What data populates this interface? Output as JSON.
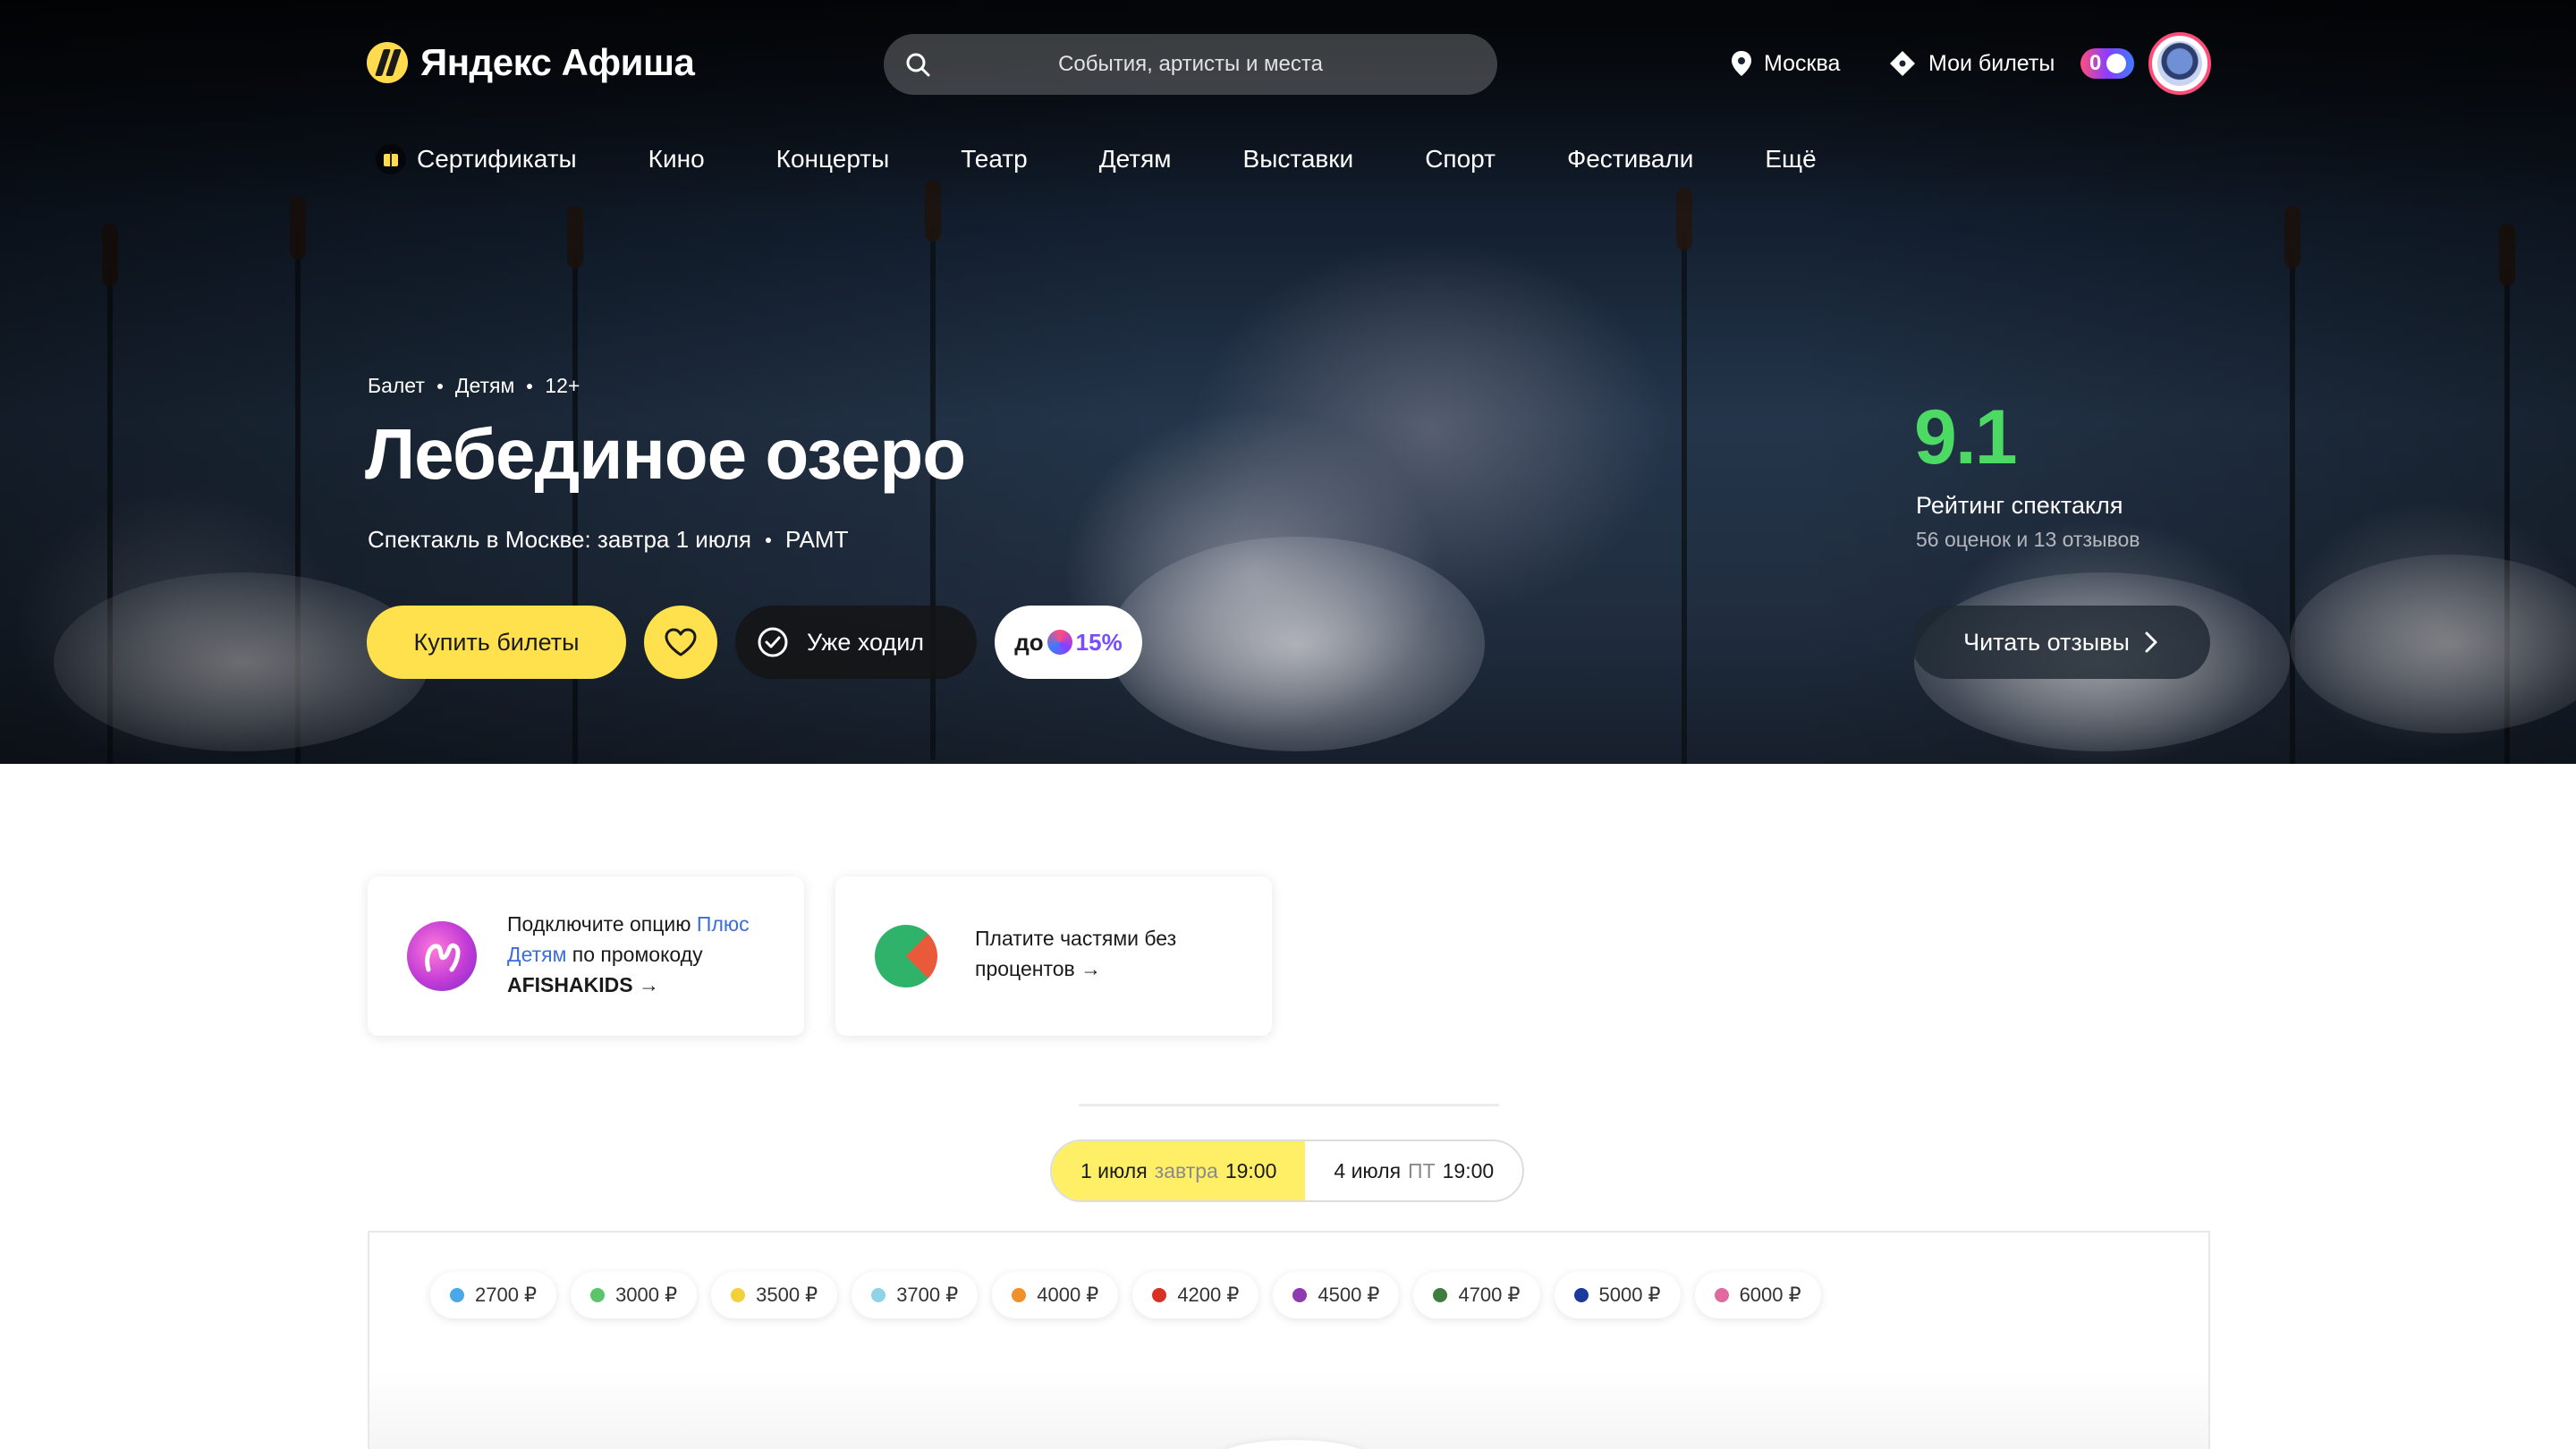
{
  "header": {
    "logo_text": "Яндекс Афиша",
    "search_placeholder": "События, артисты и места",
    "city": "Москва",
    "my_tickets": "Мои билеты",
    "plus_points": "0"
  },
  "nav": {
    "items": [
      "Сертификаты",
      "Кино",
      "Концерты",
      "Театр",
      "Детям",
      "Выставки",
      "Спорт",
      "Фестивали",
      "Ещё"
    ]
  },
  "event": {
    "tags": [
      "Балет",
      "Детям",
      "12+"
    ],
    "title": "Лебединое озеро",
    "subtitle_main": "Спектакль в Москве: завтра 1 июля",
    "venue": "РАМТ",
    "buy_label": "Купить билеты",
    "went_label": "Уже ходил",
    "cashback_prefix": "до",
    "cashback_value": "15%"
  },
  "rating": {
    "value": "9.1",
    "label": "Рейтинг спектакля",
    "count": "56 оценок  и 13 отзывов",
    "reviews_button": "Читать отзывы"
  },
  "promos": {
    "plus": {
      "text_1": "Подключите опцию ",
      "link": "Плюс Детям",
      "text_2": " по промокоду",
      "code": "AFISHAKIDS →"
    },
    "split": {
      "text": "Платите частями без процентов →"
    }
  },
  "dates": [
    {
      "date": "1 июля",
      "day": "завтра",
      "time": "19:00",
      "active": true
    },
    {
      "date": "4 июля",
      "day": "ПТ",
      "time": "19:00",
      "active": false
    }
  ],
  "prices": [
    {
      "label": "2700 ₽",
      "color": "#4aa8e8"
    },
    {
      "label": "3000 ₽",
      "color": "#5cc46a"
    },
    {
      "label": "3500 ₽",
      "color": "#f5cf3a"
    },
    {
      "label": "3700 ₽",
      "color": "#8fd3e8"
    },
    {
      "label": "4000 ₽",
      "color": "#f0902a"
    },
    {
      "label": "4200 ₽",
      "color": "#d93025"
    },
    {
      "label": "4500 ₽",
      "color": "#8e3ab0"
    },
    {
      "label": "4700 ₽",
      "color": "#3f7d3f"
    },
    {
      "label": "5000 ₽",
      "color": "#1a3a9c"
    },
    {
      "label": "6000 ₽",
      "color": "#e06aa0"
    }
  ],
  "colors": {
    "accent_yellow": "#ffe14d",
    "rating_green": "#4cd964",
    "plus_purple": "#7a4cff"
  }
}
